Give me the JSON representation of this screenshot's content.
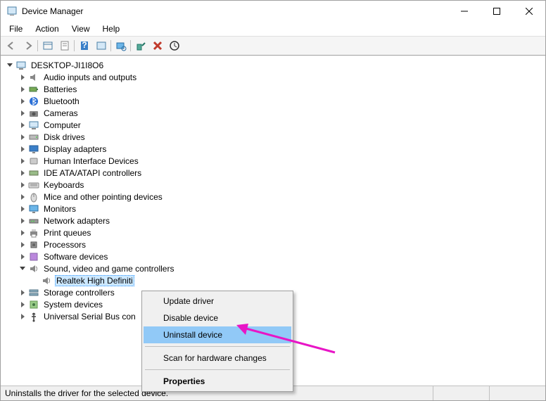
{
  "titlebar": {
    "title": "Device Manager"
  },
  "menubar": {
    "items": [
      "File",
      "Action",
      "View",
      "Help"
    ]
  },
  "tree": {
    "root": "DESKTOP-JI1I8O6",
    "categories": [
      "Audio inputs and outputs",
      "Batteries",
      "Bluetooth",
      "Cameras",
      "Computer",
      "Disk drives",
      "Display adapters",
      "Human Interface Devices",
      "IDE ATA/ATAPI controllers",
      "Keyboards",
      "Mice and other pointing devices",
      "Monitors",
      "Network adapters",
      "Print queues",
      "Processors",
      "Software devices",
      "Sound, video and game controllers",
      "Storage controllers",
      "System devices",
      "Universal Serial Bus con"
    ],
    "expanded_index": 16,
    "expanded_child": "Realtek High Definiti"
  },
  "context_menu": {
    "items": [
      {
        "label": "Update driver"
      },
      {
        "label": "Disable device"
      },
      {
        "label": "Uninstall device",
        "highlight": true
      },
      {
        "sep": true
      },
      {
        "label": "Scan for hardware changes"
      },
      {
        "sep": true
      },
      {
        "label": "Properties",
        "bold": true
      }
    ]
  },
  "statusbar": {
    "text": "Uninstalls the driver for the selected device."
  },
  "icons": {
    "categories": [
      "audio-icon",
      "battery-icon",
      "bluetooth-icon",
      "camera-icon",
      "computer-icon",
      "disk-icon",
      "display-icon",
      "hid-icon",
      "ide-icon",
      "keyboard-icon",
      "mouse-icon",
      "monitor-icon",
      "network-icon",
      "printer-icon",
      "cpu-icon",
      "software-icon",
      "sound-icon",
      "storage-icon",
      "system-icon",
      "usb-icon"
    ]
  }
}
